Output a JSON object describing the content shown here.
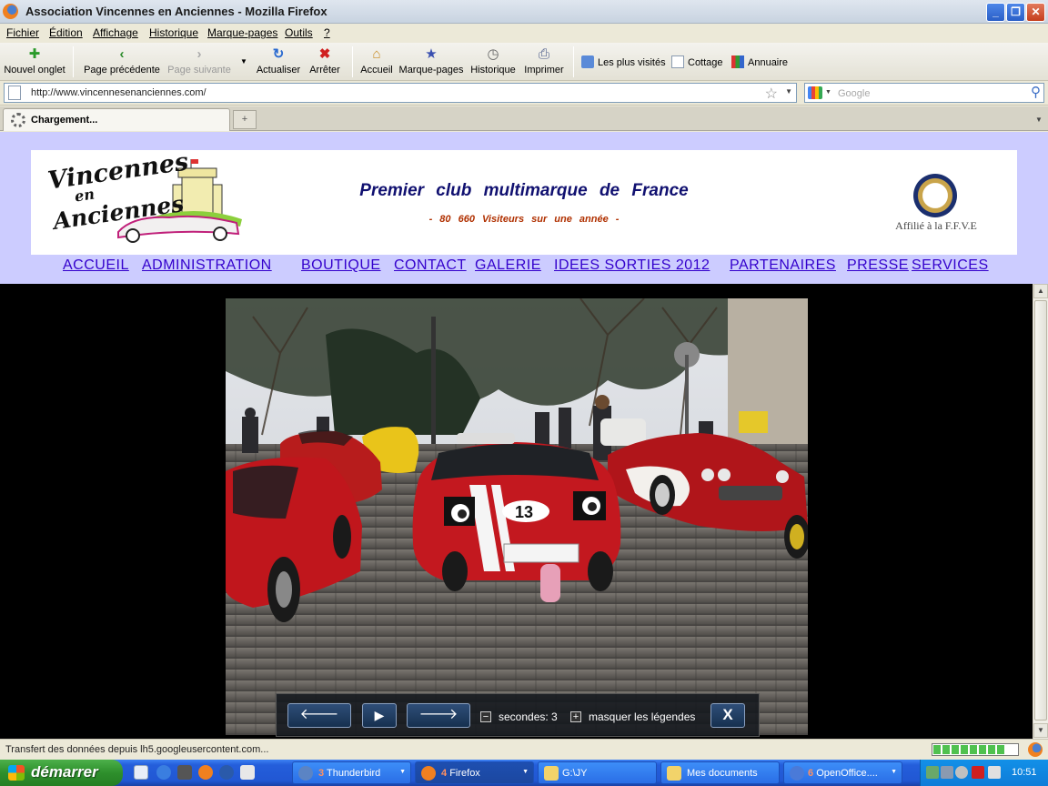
{
  "window": {
    "title": "Association Vincennes en Anciennes - Mozilla Firefox"
  },
  "menu": [
    "Fichier",
    "Édition",
    "Affichage",
    "Historique",
    "Marque-pages",
    "Outils",
    "?"
  ],
  "toolbar": {
    "new_tab": "Nouvel onglet",
    "back": "Page précédente",
    "forward": "Page suivante",
    "reload": "Actualiser",
    "stop": "Arrêter",
    "home": "Accueil",
    "bookmarks": "Marque-pages",
    "history": "Historique",
    "print": "Imprimer"
  },
  "bookmarks_bar": [
    "Les plus visités",
    "Cottage",
    "Annuaire"
  ],
  "navbar": {
    "url": "http://www.vincennesenanciennes.com/",
    "search_placeholder": "Google"
  },
  "tabs": [
    {
      "label": "Chargement...",
      "loading": true
    }
  ],
  "site": {
    "logo_line1": "Vincennes",
    "logo_line2": "en",
    "logo_line3": "Anciennes",
    "slogan": "Premier club multimarque de France",
    "visitors": "- 80 660 Visiteurs sur une année -",
    "affiliation": "Affilié à la F.F.V.E",
    "nav": [
      "ACCUEIL",
      "ADMINISTRATION",
      "BOUTIQUE",
      "CONTACT",
      "GALERIE",
      "IDEES SORTIES 2012",
      "PARTENAIRES",
      "PRESSE",
      "SERVICES"
    ]
  },
  "slideshow": {
    "seconds_label": "secondes: 3",
    "toggle_captions": "masquer les légendes",
    "close_label": "X",
    "car_number": "13"
  },
  "status": {
    "text": "Transfert des données depuis lh5.googleusercontent.com...",
    "progress": 0.85
  },
  "taskbar": {
    "start": "démarrer",
    "tasks": [
      {
        "count": "3",
        "label": "Thunderbird"
      },
      {
        "count": "4",
        "label": "Firefox"
      },
      {
        "count": "",
        "label": "G:\\JY"
      },
      {
        "count": "",
        "label": "Mes documents"
      },
      {
        "count": "6",
        "label": "OpenOffice...."
      }
    ],
    "clock": "10:51"
  },
  "colors": {
    "site_header_bg": "#ccccff",
    "slogan": "#101070",
    "nav_link": "#3300cc",
    "visitors": "#b03000",
    "taskbar": "#245edb",
    "start": "#2e8f2c"
  }
}
